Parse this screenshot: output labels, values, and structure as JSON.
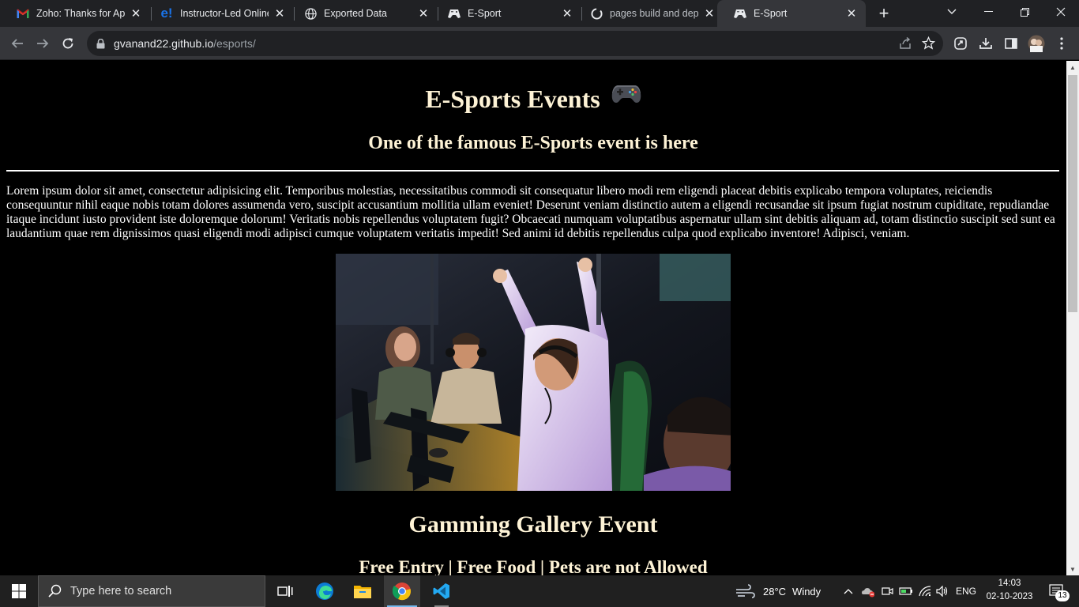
{
  "browser": {
    "tabs": [
      {
        "title": "Zoho: Thanks for App",
        "icon": "gmail-icon",
        "active": false
      },
      {
        "title": "Instructor-Led Online",
        "icon": "edureka-icon",
        "active": false
      },
      {
        "title": "Exported Data",
        "icon": "globe-icon",
        "active": false
      },
      {
        "title": "E-Sport",
        "icon": "gamepad-icon",
        "active": false
      },
      {
        "title": "pages build and depl",
        "icon": "github-icon",
        "active": false
      },
      {
        "title": "E-Sport",
        "icon": "gamepad-icon",
        "active": true
      }
    ],
    "url_domain": "gvanand22.github.io",
    "url_path": "/esports/"
  },
  "page": {
    "title": "E-Sports Events",
    "subtitle": "One of the famous E-Sports event is here",
    "paragraph": "Lorem ipsum dolor sit amet, consectetur adipisicing elit. Temporibus molestias, necessitatibus commodi sit consequatur libero modi rem eligendi placeat debitis explicabo tempora voluptates, reiciendis consequuntur nihil eaque nobis totam dolores assumenda vero, suscipit accusantium mollitia ullam eveniet! Deserunt veniam distinctio autem a eligendi recusandae sit ipsum fugiat nostrum cupiditate, repudiandae itaque incidunt iusto provident iste doloremque dolorum! Veritatis nobis repellendus voluptatem fugit? Obcaecati numquam voluptatibus aspernatur ullam sint debitis aliquam ad, totam distinctio suscipit sed sunt ea laudantium quae rem dignissimos quasi eligendi modi adipisci cumque voluptatem veritatis impedit! Sed animi id debitis repellendus culpa quod explicabo inventore! Adipisci, veniam.",
    "gallery_heading": "Gamming Gallery Event",
    "event_info": "Free Entry | Free Food | Pets are not Allowed",
    "heading_color": "#fef3d6"
  },
  "taskbar": {
    "search_placeholder": "Type here to search",
    "weather_temp": "28°C",
    "weather_desc": "Windy",
    "language": "ENG",
    "time": "14:03",
    "date": "02-10-2023",
    "notification_count": "13"
  }
}
